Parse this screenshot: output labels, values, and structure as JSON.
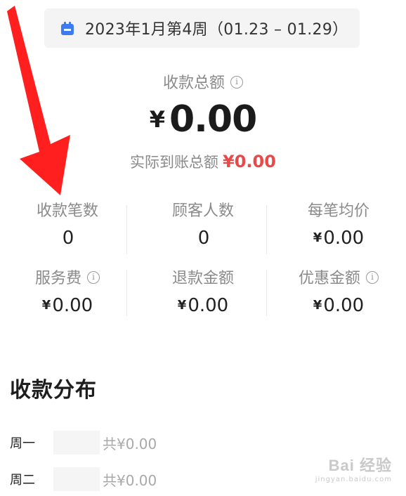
{
  "date_range": {
    "label": "2023年1月第4周（01.23 – 01.29）",
    "icon": "calendar-icon",
    "icon_color": "#3e7bf0"
  },
  "totals": {
    "total_label": "收款总额",
    "info_glyph": "i",
    "currency": "¥",
    "total_amount": "0.00",
    "actual_label": "实际到账总额",
    "actual_amount": "¥0.00",
    "actual_color": "#e84a4a"
  },
  "stats": [
    {
      "label": "收款笔数",
      "value": "0",
      "currency": "",
      "has_info": false
    },
    {
      "label": "顾客人数",
      "value": "0",
      "currency": "",
      "has_info": false
    },
    {
      "label": "每笔均价",
      "value": "0.00",
      "currency": "¥",
      "has_info": false
    },
    {
      "label": "服务费",
      "value": "0.00",
      "currency": "¥",
      "has_info": true
    },
    {
      "label": "退款金额",
      "value": "0.00",
      "currency": "¥",
      "has_info": false
    },
    {
      "label": "优惠金额",
      "value": "0.00",
      "currency": "¥",
      "has_info": true
    }
  ],
  "distribution": {
    "title": "收款分布",
    "rows": [
      {
        "day": "周一",
        "sum": "共¥0.00"
      },
      {
        "day": "周二",
        "sum": "共¥0.00"
      }
    ]
  },
  "watermark": {
    "main": "Bai 经验",
    "sub": "jingyan.baidu.com"
  },
  "annotation": {
    "arrow_color": "#ff1f1f"
  }
}
